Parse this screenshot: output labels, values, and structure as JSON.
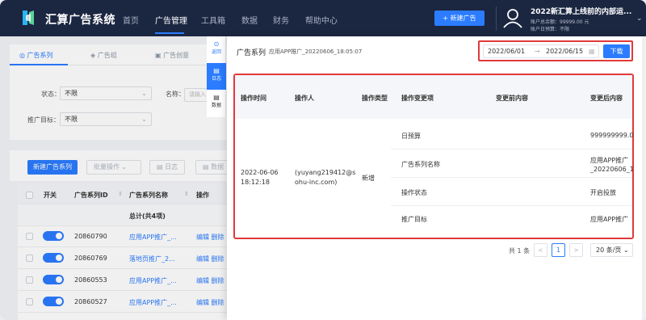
{
  "app": {
    "name": "汇算广告系统"
  },
  "nav": {
    "items": [
      "首页",
      "广告管理",
      "工具箱",
      "数据",
      "财务",
      "帮助中心"
    ],
    "active": "广告管理",
    "new_ad_button": "+ 新建广告"
  },
  "user": {
    "title": "2022新汇算上线前的内部运...",
    "balance": "账户总余额：99999.00 元",
    "budget": "账户日预算：不限"
  },
  "tabs": [
    "广告系列",
    "广告组",
    "广告创意"
  ],
  "filters": {
    "status_label": "状态：",
    "status_value": "不限",
    "name_label": "名称：",
    "name_placeholder": "请输入",
    "target_label": "推广目标：",
    "target_value": "不限"
  },
  "actions": {
    "new_series": "新建广告系列",
    "batch": "批量操作",
    "log": "日志",
    "data": "数据"
  },
  "table": {
    "headers": [
      "开关",
      "广告系列ID",
      "广告系列名称",
      "操作"
    ],
    "total": "总计(共4项)",
    "rows": [
      {
        "id": "20860790",
        "name": "应用APP推广_...",
        "ops": "编辑  删除"
      },
      {
        "id": "20860769",
        "name": "落地页推广_2...",
        "ops": "编辑  删除"
      },
      {
        "id": "20860553",
        "name": "应用APP推广_...",
        "ops": "编辑  删除"
      },
      {
        "id": "20860527",
        "name": "应用APP推广_...",
        "ops": "编辑  删除"
      }
    ]
  },
  "side_tabs": [
    "返回",
    "日志",
    "数据"
  ],
  "drawer": {
    "title": "广告系列",
    "subtitle": "应用APP推广_20220606_18:05:07",
    "date_start": "2022/06/01",
    "date_sep": "→",
    "date_end": "2022/06/15",
    "download": "下载",
    "log_headers": [
      "操作时间",
      "操作人",
      "操作类型",
      "操作变更项",
      "变更前内容",
      "变更后内容"
    ],
    "log_entry": {
      "time_line1": "2022-06-06",
      "time_line2": "18:12:18",
      "operator_line1": "(yuyang219412@s",
      "operator_line2": "ohu-inc.com)",
      "type": "新增",
      "changes": [
        {
          "item": "日预算",
          "before": "",
          "after": [
            "999999999.0"
          ]
        },
        {
          "item": "广告系列名称",
          "before": "",
          "after": [
            "应用APP推广",
            "_20220606_1"
          ]
        },
        {
          "item": "操作状态",
          "before": "",
          "after": [
            "开启投放"
          ]
        },
        {
          "item": "推广目标",
          "before": "",
          "after": [
            "应用APP推广"
          ]
        }
      ]
    },
    "pager": {
      "total": "共 1 条",
      "prev": "<",
      "page": "1",
      "next": ">",
      "size": "20 条/页"
    }
  },
  "colors": {
    "primary": "#2b7cff",
    "nav_bg": "#1b2640",
    "highlight": "#e0393a"
  }
}
